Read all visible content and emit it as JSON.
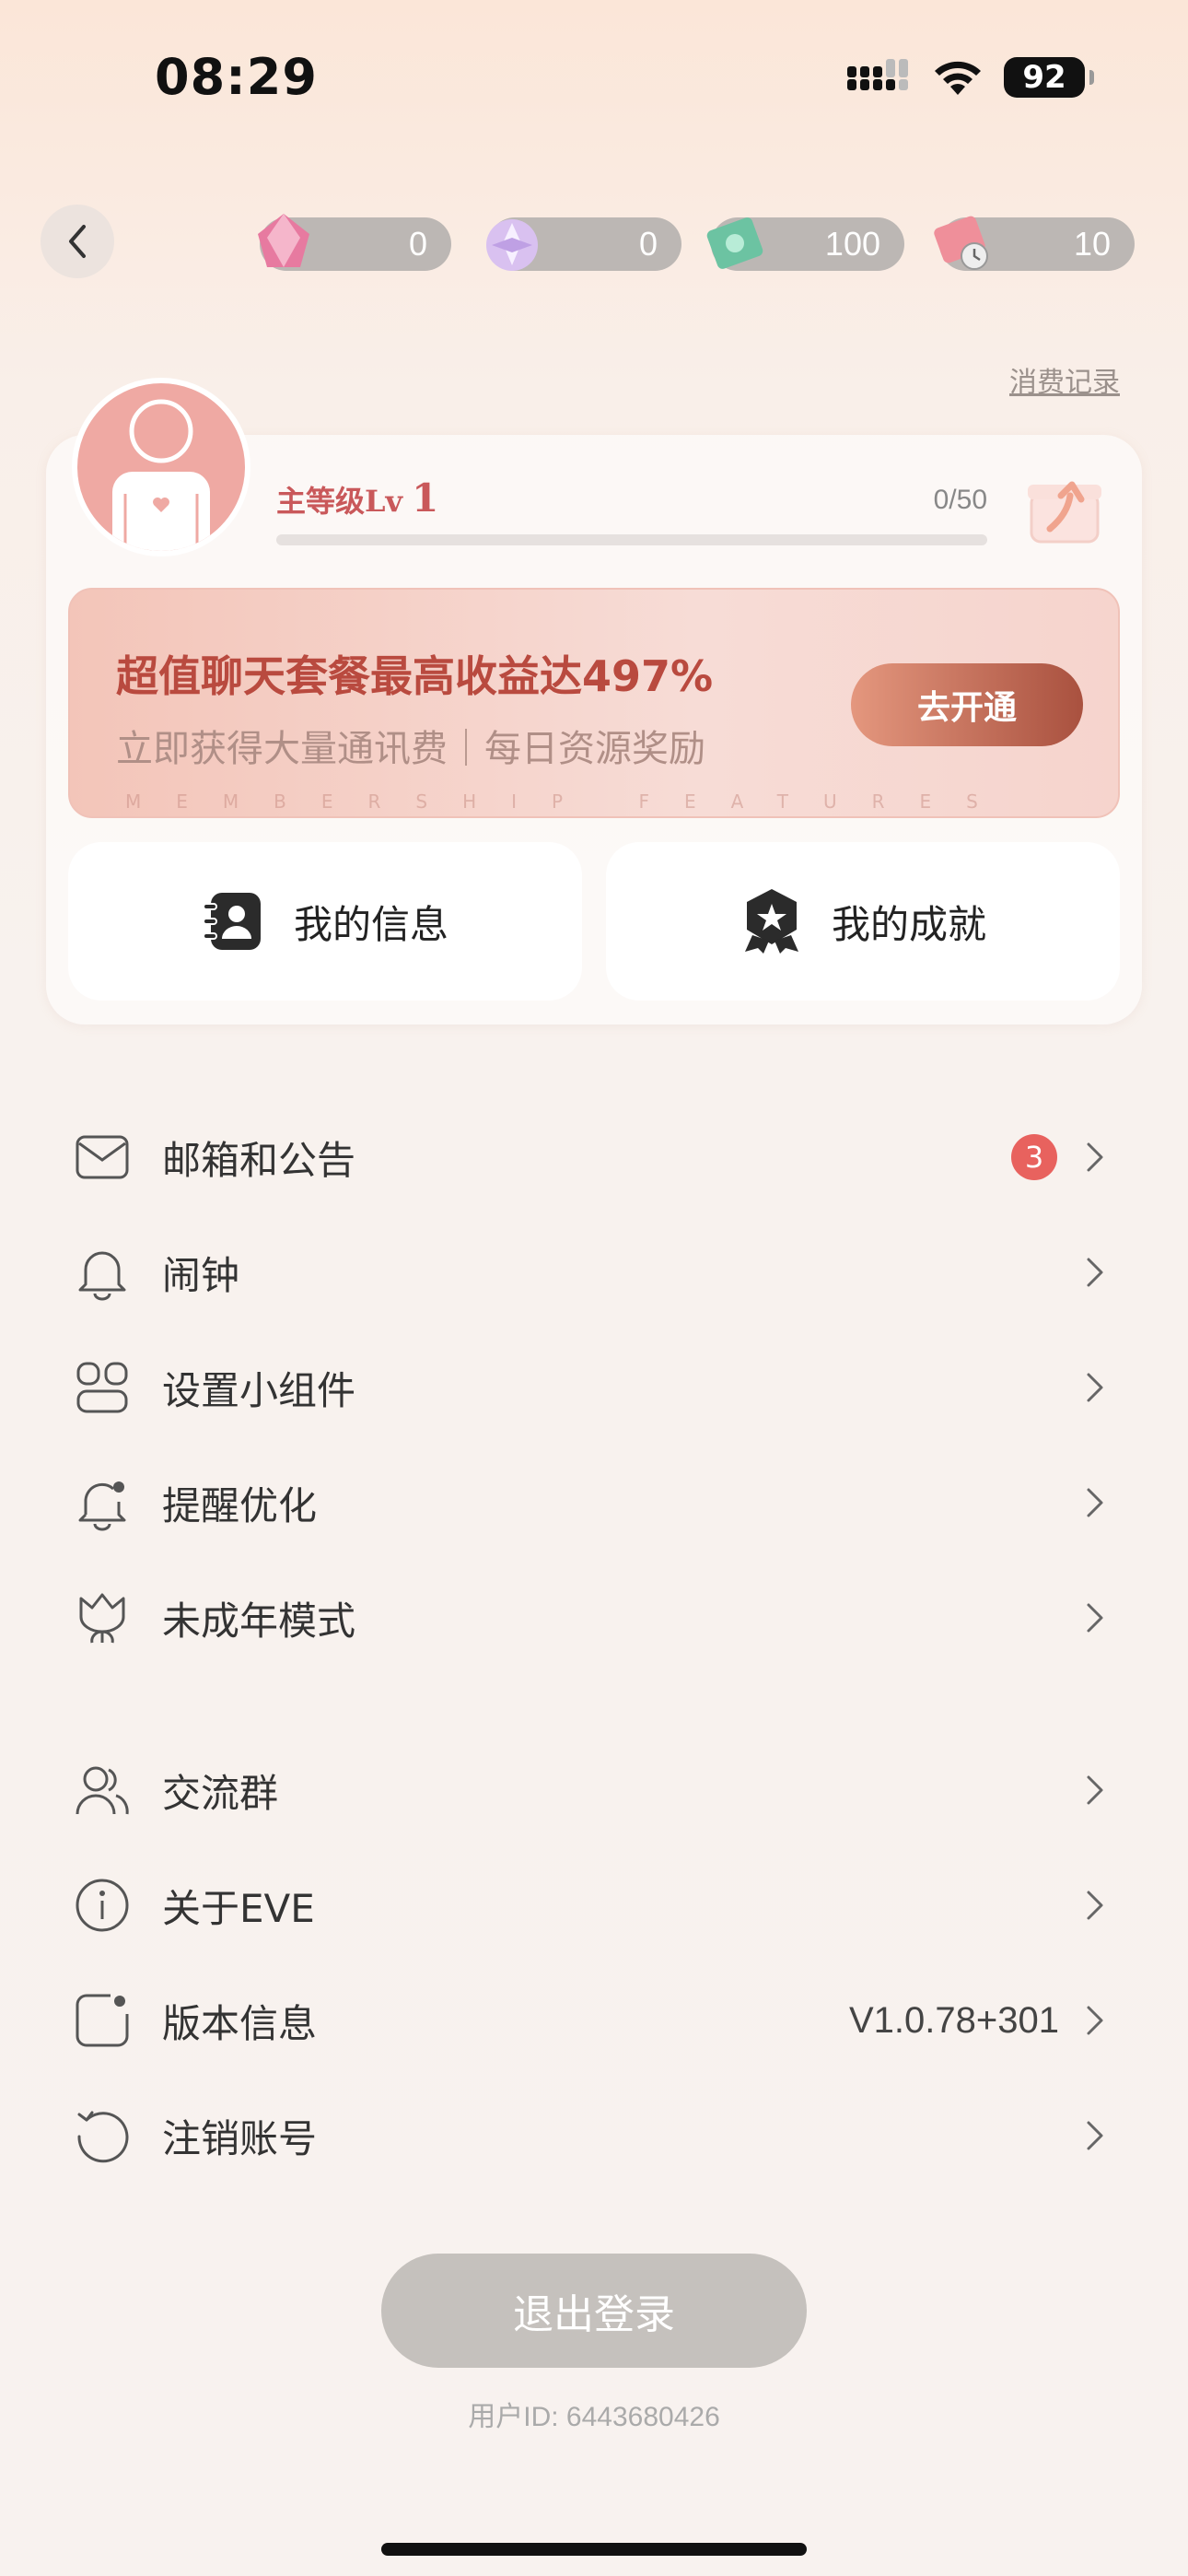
{
  "status_bar": {
    "time": "08:29",
    "battery": "92"
  },
  "currencies": [
    {
      "name": "pink-crystal",
      "value": "0",
      "color": "#e77aa0"
    },
    {
      "name": "purple-orb",
      "value": "0",
      "color": "#c9a6e8"
    },
    {
      "name": "green-ticket",
      "value": "100",
      "color": "#6cc3a2"
    },
    {
      "name": "timed-ticket",
      "value": "10",
      "color": "#ef8f9a"
    }
  ],
  "consume_link": "消费记录",
  "profile": {
    "level_label": "主等级Lv",
    "level": "1",
    "progress_text": "0/50",
    "progress_fraction": 0
  },
  "promo": {
    "title": "超值聊天套餐最高收益达497%",
    "subtitle": "立即获得大量通讯费｜每日资源奖励",
    "button": "去开通",
    "footer": "MEMBERSHIP FEATURES"
  },
  "quick_buttons": [
    {
      "label": "我的信息",
      "icon": "contact-card-icon"
    },
    {
      "label": "我的成就",
      "icon": "achievement-badge-icon"
    }
  ],
  "menu": [
    {
      "label": "邮箱和公告",
      "icon": "mail-icon",
      "badge": "3"
    },
    {
      "label": "闹钟",
      "icon": "bell-icon"
    },
    {
      "label": "设置小组件",
      "icon": "widget-icon"
    },
    {
      "label": "提醒优化",
      "icon": "notification-bell-icon"
    },
    {
      "label": "未成年模式",
      "icon": "flower-icon"
    },
    {
      "label": "交流群",
      "icon": "group-icon"
    },
    {
      "label": "关于EVE",
      "icon": "info-icon"
    },
    {
      "label": "版本信息",
      "icon": "version-icon",
      "value": "V1.0.78+301"
    },
    {
      "label": "注销账号",
      "icon": "refresh-icon"
    }
  ],
  "logout_button": "退出登录",
  "user_id": "用户ID: 6443680426",
  "colors": {
    "accent": "#b94a3f",
    "badge": "#e8625e"
  }
}
